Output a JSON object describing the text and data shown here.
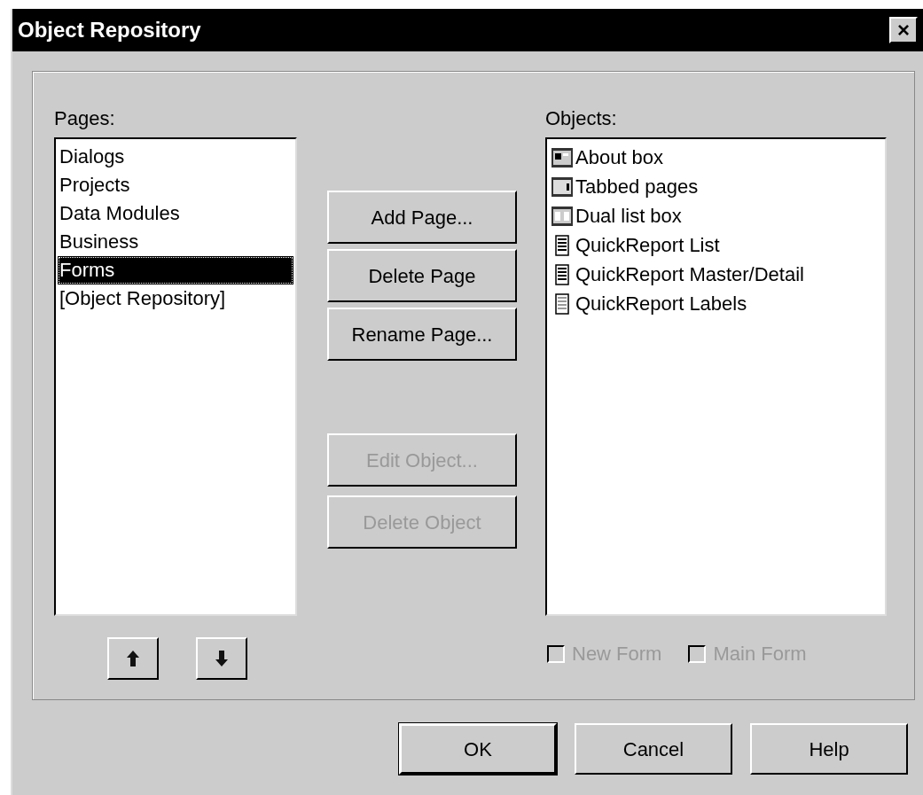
{
  "window": {
    "title": "Object Repository",
    "close": "×"
  },
  "pages": {
    "label": "Pages:",
    "items": [
      {
        "label": "Dialogs",
        "selected": false
      },
      {
        "label": "Projects",
        "selected": false
      },
      {
        "label": "Data Modules",
        "selected": false
      },
      {
        "label": "Business",
        "selected": false
      },
      {
        "label": "Forms",
        "selected": true
      },
      {
        "label": "[Object Repository]",
        "selected": false
      }
    ]
  },
  "page_buttons": [
    {
      "label": "Add Page...",
      "disabled": false
    },
    {
      "label": "Delete Page",
      "disabled": false
    },
    {
      "label": "Rename Page...",
      "disabled": false
    }
  ],
  "object_buttons": [
    {
      "label": "Edit Object...",
      "disabled": true
    },
    {
      "label": "Delete Object",
      "disabled": true
    }
  ],
  "objects": {
    "label": "Objects:",
    "items": [
      {
        "label": "About box",
        "kind": "about"
      },
      {
        "label": "Tabbed pages",
        "kind": "tabbed"
      },
      {
        "label": "Dual list box",
        "kind": "dual"
      },
      {
        "label": "QuickReport List",
        "kind": "report"
      },
      {
        "label": "QuickReport Master/Detail",
        "kind": "report"
      },
      {
        "label": "QuickReport Labels",
        "kind": "labels"
      }
    ]
  },
  "options": [
    {
      "label": "New Form",
      "checked": false,
      "disabled": true
    },
    {
      "label": "Main Form",
      "checked": false,
      "disabled": true
    }
  ],
  "footer_buttons": [
    "OK",
    "Cancel",
    "Help"
  ]
}
